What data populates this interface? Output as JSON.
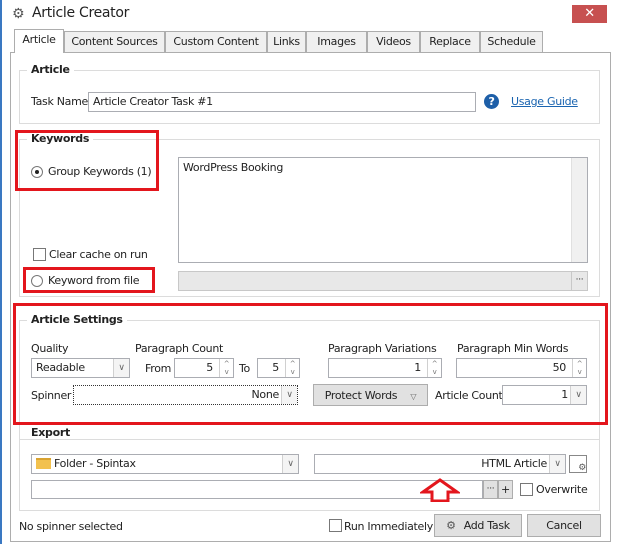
{
  "window": {
    "title": "Article Creator",
    "close": "✕"
  },
  "tabs": [
    "Article",
    "Content Sources",
    "Custom Content",
    "Links",
    "Images",
    "Videos",
    "Replace",
    "Schedule"
  ],
  "article": {
    "title": "Article",
    "task_name_label": "Task Name",
    "task_name": "Article Creator Task #1",
    "usage_guide": "Usage Guide",
    "help": "?"
  },
  "keywords": {
    "title": "Keywords",
    "group_keywords": "Group Keywords (1)",
    "keywords_text": "WordPress Booking",
    "clear_cache": "Clear cache on run",
    "keyword_from_file": "Keyword from file",
    "browse": "···"
  },
  "settings": {
    "title": "Article Settings",
    "quality_label": "Quality",
    "quality": "Readable",
    "paragraph_count_label": "Paragraph Count",
    "from_label": "From",
    "from": "5",
    "to_label": "To",
    "to": "5",
    "variations_label": "Paragraph Variations",
    "variations": "1",
    "min_words_label": "Paragraph Min Words",
    "min_words": "50",
    "spinner_label": "Spinner",
    "spinner": "None",
    "protect_words": "Protect Words",
    "article_count_label": "Article Count",
    "article_count": "1"
  },
  "export": {
    "title": "Export",
    "folder": "Folder - Spintax",
    "format": "HTML Article",
    "path": "",
    "browse": "···",
    "add": "+",
    "overwrite": "Overwrite"
  },
  "footer": {
    "status": "No spinner selected",
    "run_immediately": "Run Immediately",
    "add_task": "Add Task",
    "cancel": "Cancel"
  }
}
